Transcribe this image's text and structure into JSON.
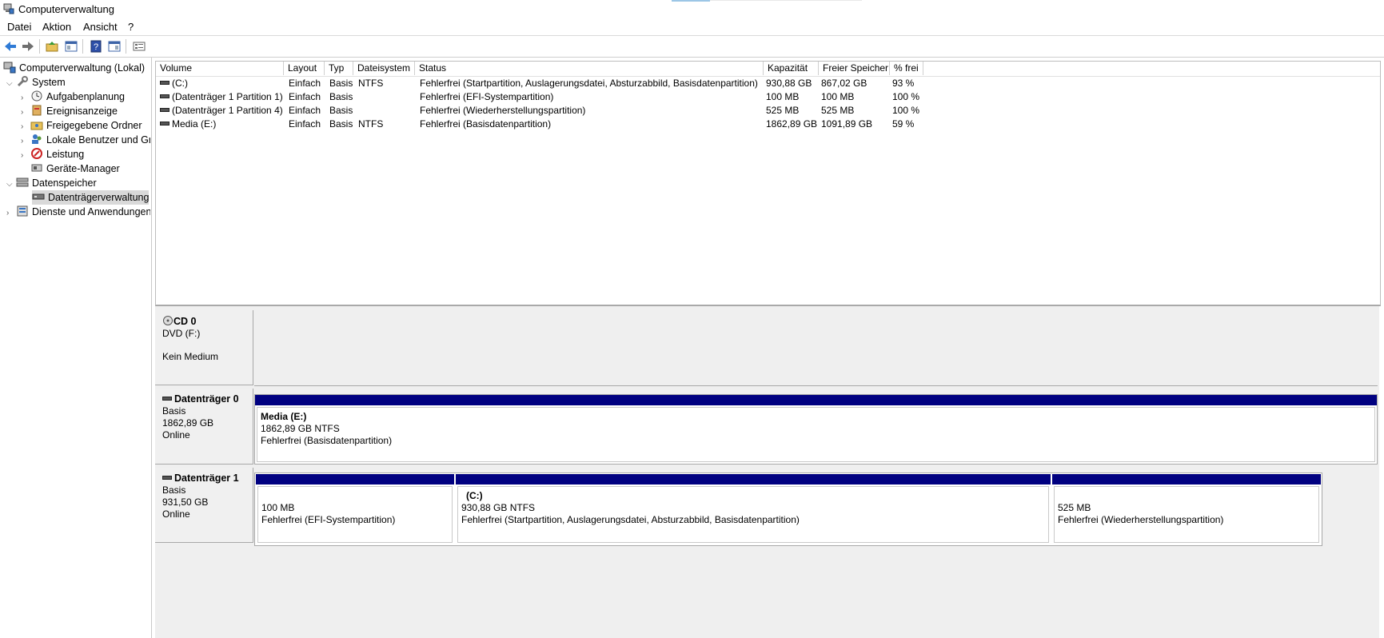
{
  "window": {
    "title": "Computerverwaltung"
  },
  "menu": [
    "Datei",
    "Aktion",
    "Ansicht",
    "?"
  ],
  "tree": {
    "root": "Computerverwaltung (Lokal)",
    "system": "System",
    "aufgabenplanung": "Aufgabenplanung",
    "ereignisanzeige": "Ereignisanzeige",
    "freigegebene_ordner": "Freigegebene Ordner",
    "lokale_benutzer": "Lokale Benutzer und Gr",
    "leistung": "Leistung",
    "geraete_manager": "Geräte-Manager",
    "datenspeicher": "Datenspeicher",
    "datentraegerverwaltung": "Datenträgerverwaltung",
    "dienste": "Dienste und Anwendungen"
  },
  "volumes": {
    "columns": [
      "Volume",
      "Layout",
      "Typ",
      "Dateisystem",
      "Status",
      "Kapazität",
      "Freier Speicher",
      "% frei"
    ],
    "rows": [
      {
        "volume": "(C:)",
        "layout": "Einfach",
        "typ": "Basis",
        "fs": "NTFS",
        "status": "Fehlerfrei (Startpartition, Auslagerungsdatei, Absturzabbild, Basisdatenpartition)",
        "kap": "930,88 GB",
        "frei": "867,02 GB",
        "pct": "93 %"
      },
      {
        "volume": "(Datenträger 1 Partition 1)",
        "layout": "Einfach",
        "typ": "Basis",
        "fs": "",
        "status": "Fehlerfrei (EFI-Systempartition)",
        "kap": "100 MB",
        "frei": "100 MB",
        "pct": "100 %"
      },
      {
        "volume": "(Datenträger 1 Partition 4)",
        "layout": "Einfach",
        "typ": "Basis",
        "fs": "",
        "status": "Fehlerfrei (Wiederherstellungspartition)",
        "kap": "525 MB",
        "frei": "525 MB",
        "pct": "100 %"
      },
      {
        "volume": "Media (E:)",
        "layout": "Einfach",
        "typ": "Basis",
        "fs": "NTFS",
        "status": "Fehlerfrei (Basisdatenpartition)",
        "kap": "1862,89 GB",
        "frei": "1091,89 GB",
        "pct": "59 %"
      }
    ]
  },
  "disks": {
    "cd0": {
      "name": "CD 0",
      "line1": "DVD (F:)",
      "line2": "Kein Medium"
    },
    "disk0": {
      "name": "Datenträger 0",
      "type": "Basis",
      "size": "1862,89 GB",
      "state": "Online",
      "parts": [
        {
          "title": "Media  (E:)",
          "size": "1862,89 GB NTFS",
          "status": "Fehlerfrei (Basisdatenpartition)"
        }
      ]
    },
    "disk1": {
      "name": "Datenträger 1",
      "type": "Basis",
      "size": "931,50 GB",
      "state": "Online",
      "parts": [
        {
          "title": "",
          "size": "100 MB",
          "status": "Fehlerfrei (EFI-Systempartition)"
        },
        {
          "title": "(C:)",
          "size": "930,88 GB NTFS",
          "status": "Fehlerfrei (Startpartition, Auslagerungsdatei, Absturzabbild, Basisdatenpartition)"
        },
        {
          "title": "",
          "size": "525 MB",
          "status": "Fehlerfrei (Wiederherstellungspartition)"
        }
      ]
    }
  },
  "colors": {
    "partition_bar": "#000080",
    "selection": "#d9d9d9"
  }
}
